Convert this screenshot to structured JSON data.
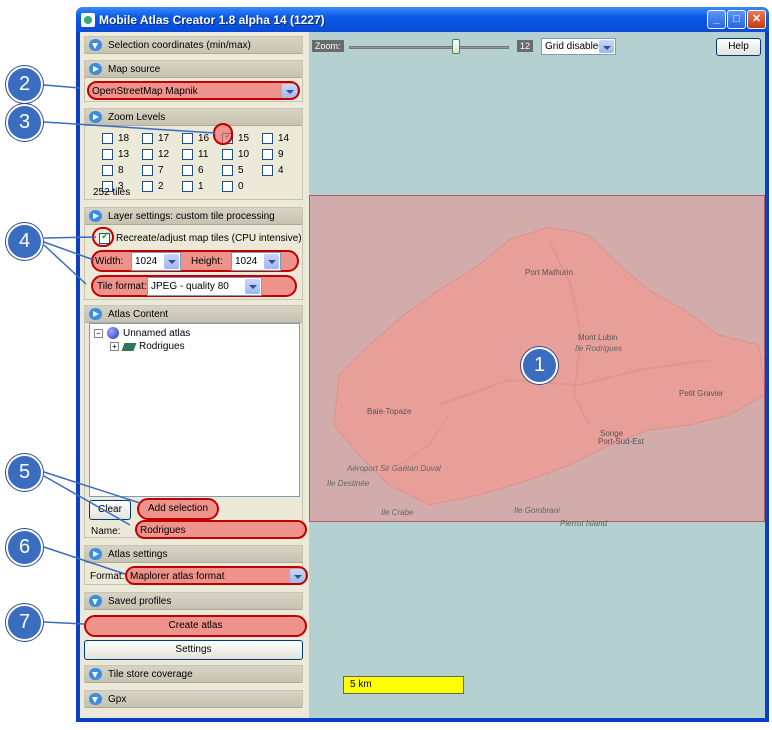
{
  "window": {
    "title": "Mobile Atlas Creator 1.8 alpha 14 (1227)"
  },
  "sections": {
    "selection_coords": "Selection coordinates (min/max)",
    "map_source": "Map source",
    "zoom_levels": "Zoom Levels",
    "layer_settings": "Layer settings: custom tile processing",
    "atlas_content": "Atlas Content",
    "atlas_settings": "Atlas settings",
    "saved_profiles": "Saved profiles",
    "tile_store": "Tile store coverage",
    "gpx": "Gpx"
  },
  "map_source": {
    "value": "OpenStreetMap Mapnik"
  },
  "zoom": {
    "levels": [
      "18",
      "17",
      "16",
      "15",
      "14",
      "13",
      "12",
      "11",
      "10",
      "9",
      "8",
      "7",
      "6",
      "5",
      "4",
      "3",
      "2",
      "1",
      "0"
    ],
    "checked": [
      "15"
    ],
    "tiles": "252 tiles"
  },
  "layer": {
    "recreate_label": "Recreate/adjust map tiles (CPU intensive)",
    "width_label": "Width:",
    "width_value": "1024",
    "height_label": "Height:",
    "height_value": "1024",
    "format_label": "Tile format:",
    "format_value": "JPEG - quality 80"
  },
  "atlas": {
    "root": "Unnamed atlas",
    "child": "Rodrigues",
    "clear_label": "Clear",
    "add_label": "Add selection",
    "name_label": "Name:",
    "name_value": "Rodrigues"
  },
  "atlas_settings": {
    "format_label": "Format:",
    "format_value": "Maplorer atlas format"
  },
  "buttons": {
    "create": "Create atlas",
    "settings": "Settings",
    "help": "Help"
  },
  "toolbar": {
    "zoom_label": "Zoom:",
    "zoom_value": "12",
    "zoom_fraction": 0.67,
    "grid_value": "Grid disabled"
  },
  "map_labels": {
    "port_mathurin": "Port Mathurin",
    "mont_lubin": "Mont Lubin",
    "ile_rodrigues": "Ile Rodrigues",
    "baie_topaze": "Baie-Topaze",
    "petit_gravier": "Petit Gravier",
    "songe": "Songe",
    "port_sud_est": "Port-Sud-Est",
    "aeroport": "Aéroport Sir Gaëtan Duval",
    "ile_destinee": "Ile Destinée",
    "ile_crabe": "Ile Crabe",
    "ile_gombrani": "Ile Gombrani",
    "pierrot_island": "Pierrot Island"
  },
  "scale": "5 km",
  "callouts": [
    "1",
    "2",
    "3",
    "4",
    "5",
    "6",
    "7"
  ]
}
